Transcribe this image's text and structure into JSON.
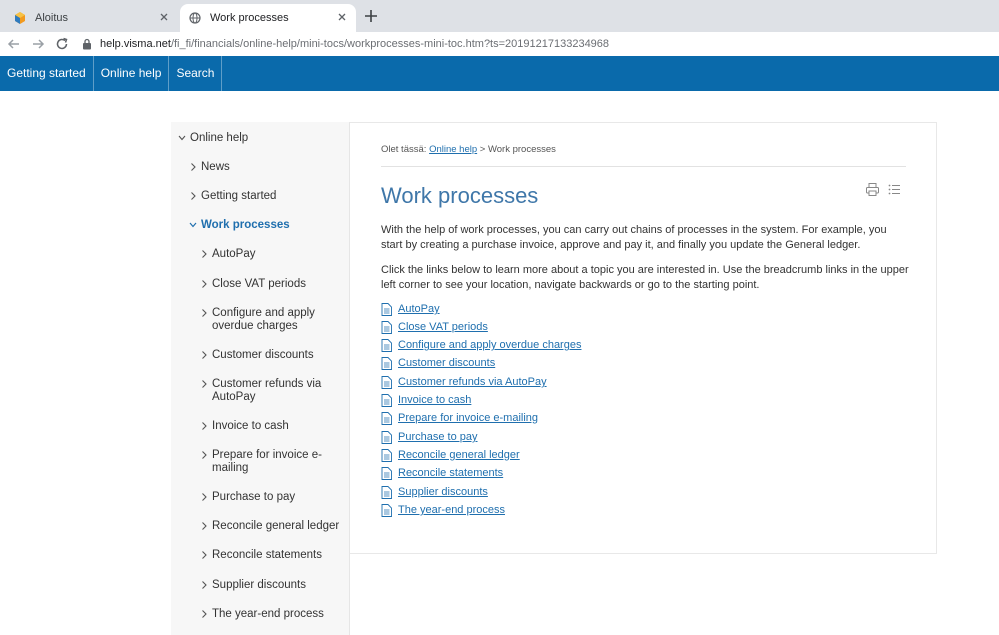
{
  "browser": {
    "tabs": [
      {
        "title": "Aloitus"
      },
      {
        "title": "Work processes"
      }
    ],
    "url_host": "help.visma.net",
    "url_path": "/fi_fi/financials/online-help/mini-tocs/workprocesses-mini-toc.htm?ts=20191217133234968"
  },
  "sitenav": {
    "items": [
      "Getting started",
      "Online help",
      "Search"
    ]
  },
  "sidebar": {
    "root": "Online help",
    "items": [
      "News",
      "Getting started"
    ],
    "current": "Work processes",
    "children": [
      "AutoPay",
      "Close VAT periods",
      "Configure and apply overdue charges",
      "Customer discounts",
      "Customer refunds via AutoPay",
      "Invoice to cash",
      "Prepare for invoice e-mailing",
      "Purchase to pay",
      "Reconcile general ledger",
      "Reconcile statements",
      "Supplier discounts",
      "The year-end process"
    ]
  },
  "main": {
    "breadcrumb_prefix": "Olet tässä:",
    "breadcrumb_link": "Online help",
    "breadcrumb_current": "> Work processes",
    "title": "Work processes",
    "intro": "With the help of work processes, you can carry out chains of processes in the system. For example, you start by creating a purchase invoice, approve and pay it, and finally you update the General ledger.",
    "instructions": "Click the links below to learn more about a topic you are interested in. Use the breadcrumb links in the upper left corner to see your location, navigate backwards or go to the starting point.",
    "links": [
      "AutoPay",
      "Close VAT periods",
      "Configure and apply overdue charges",
      "Customer discounts",
      "Customer refunds via AutoPay",
      "Invoice to cash",
      "Prepare for invoice e-mailing",
      "Purchase to pay",
      "Reconcile general ledger",
      "Reconcile statements",
      "Supplier discounts",
      "The year-end process"
    ]
  },
  "colors": {
    "nav_bg": "#0a6aab",
    "link": "#1f6fae",
    "title": "#3f77a9"
  }
}
